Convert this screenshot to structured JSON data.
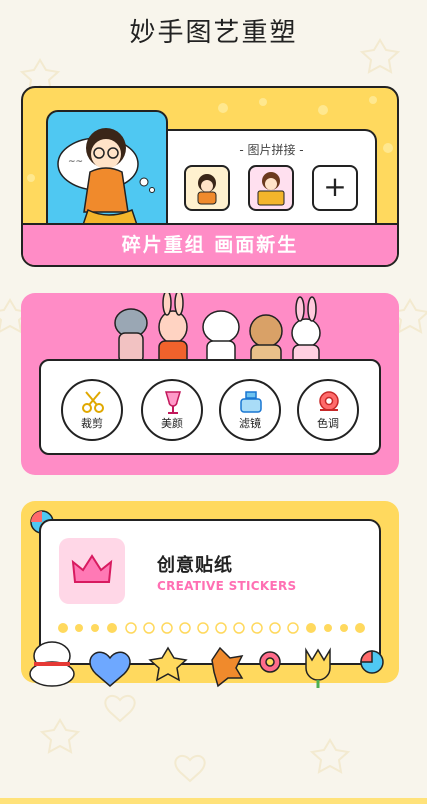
{
  "page": {
    "title": "妙手图艺重塑"
  },
  "collage": {
    "label": "- 图片拼接 -",
    "add_label": "+",
    "banner": "碎片重组  画面新生",
    "thumbs": [
      "thumb-girl-sticker",
      "thumb-girl-box-sticker"
    ]
  },
  "tools": {
    "items": [
      {
        "label": "裁剪",
        "icon": "scissors-icon"
      },
      {
        "label": "美颜",
        "icon": "cup-icon"
      },
      {
        "label": "滤镜",
        "icon": "bottle-icon"
      },
      {
        "label": "色调",
        "icon": "tape-icon"
      }
    ]
  },
  "stickers": {
    "title": "创意贴纸",
    "subtitle": "CREATIVE STICKERS",
    "icon": "crown-icon"
  },
  "colors": {
    "yellow": "#ffd95e",
    "pink": "#ff8cc6",
    "accent_pink": "#ff6fb3",
    "background": "#f8f5ec"
  }
}
